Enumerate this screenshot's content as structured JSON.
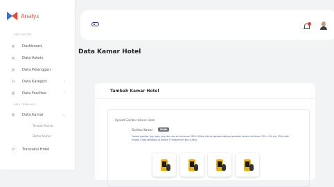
{
  "brand": {
    "name": "Analys"
  },
  "sidebar": {
    "sections": [
      {
        "label": "DATA MASTER"
      },
      {
        "label": "DATA TRANSAKSI"
      }
    ],
    "items": [
      {
        "label": "Dashboard",
        "icon": "dashboard-icon"
      },
      {
        "label": "Data Admin",
        "icon": "admin-icon"
      },
      {
        "label": "Data Pelanggan",
        "icon": "customer-icon"
      },
      {
        "label": "Data Kategori",
        "icon": "category-icon"
      },
      {
        "label": "Data Fasilitas",
        "icon": "facility-icon"
      },
      {
        "label": "Data Kamar",
        "icon": "room-icon"
      },
      {
        "label": "Transaksi Hotel",
        "icon": "transaction-icon"
      }
    ],
    "subitems": [
      {
        "label": "Tambah Kamar"
      },
      {
        "label": "Daftar Kamar"
      }
    ]
  },
  "topbar": {
    "icons": [
      "toggle-icon",
      "bell-icon",
      "avatar"
    ]
  },
  "page": {
    "title": "Data Kamar Hotel"
  },
  "card": {
    "title": "Tambah Kamar Hotel",
    "upload_title": "Upload Gambar Kamar Hotel",
    "field_label": "Gambar Kamar",
    "badge": "Wajib",
    "help_text": "Format gambar .jpg .jpeg .png dan ukuran minimum 300 x 300px (Untuk gambar optimal gunakan ukuran minimum 700 x 700 px). Pilih Lebih hingga 4 foto sekaligus di antara 3 (maksimum ada 4 foto)."
  },
  "colors": {
    "brand_left": "#3b6fd8",
    "brand_right": "#e8462f",
    "accent": "#2a2f8a"
  }
}
